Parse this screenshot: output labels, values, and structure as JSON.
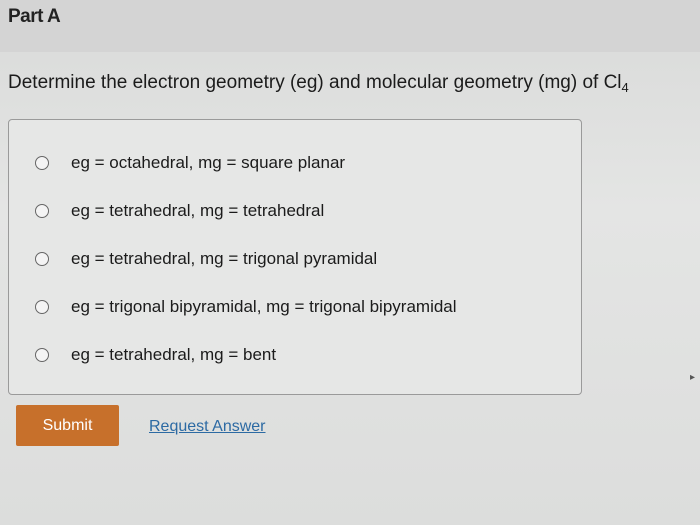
{
  "part": {
    "title": "Part A"
  },
  "question": {
    "text": "Determine the electron geometry (eg) and molecular geometry (mg) of Cl",
    "subscript": "4"
  },
  "options": [
    {
      "label": "eg = octahedral, mg = square planar",
      "selected": false
    },
    {
      "label": "eg = tetrahedral, mg = tetrahedral",
      "selected": false
    },
    {
      "label": "eg = tetrahedral, mg = trigonal pyramidal",
      "selected": false
    },
    {
      "label": "eg = trigonal bipyramidal, mg = trigonal bipyramidal",
      "selected": false
    },
    {
      "label": "eg = tetrahedral, mg = bent",
      "selected": false
    }
  ],
  "actions": {
    "submit_label": "Submit",
    "request_answer_label": "Request Answer"
  },
  "colors": {
    "submit_bg": "#c7702b",
    "link": "#2c6aa3"
  }
}
